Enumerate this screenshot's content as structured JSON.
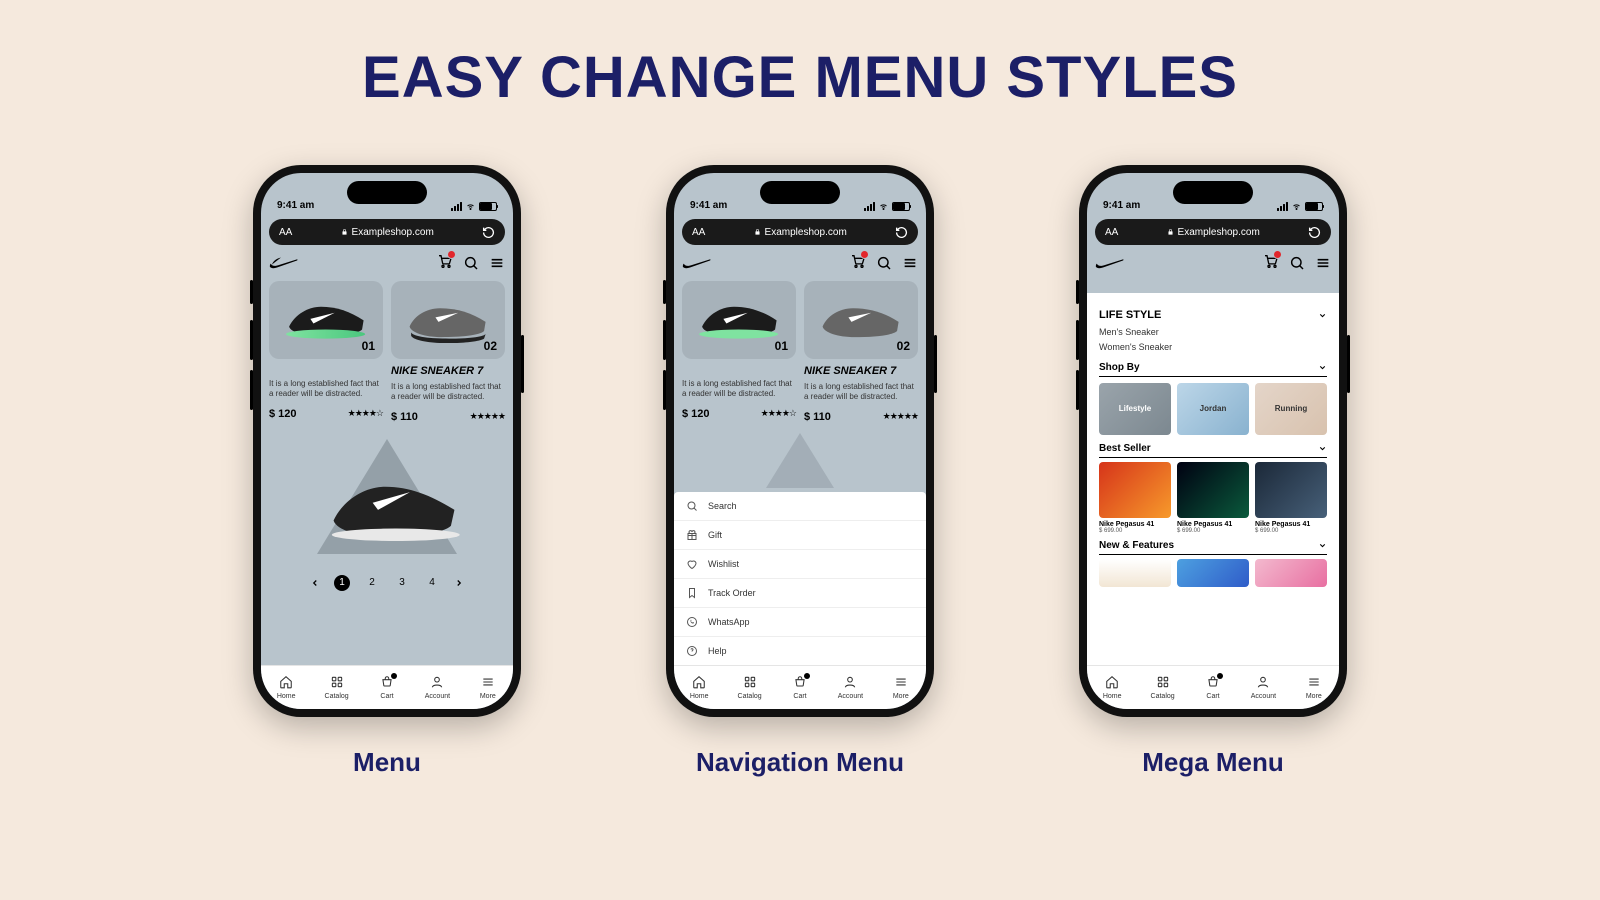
{
  "headline": "EASY CHANGE MENU STYLES",
  "captions": {
    "menu": "Menu",
    "nav": "Navigation Menu",
    "mega": "Mega Menu"
  },
  "status": {
    "time": "9:41 am"
  },
  "address": {
    "aa": "AA",
    "url": "Exampleshop.com"
  },
  "products": {
    "card1_num": "01",
    "card2_num": "02",
    "p2_name": "NIKE SNEAKER 7",
    "desc": "It is a long established fact that a reader will be distracted.",
    "p1_price": "$ 120",
    "p1_stars": "★★★★☆",
    "p2_price": "$ 110",
    "p2_stars": "★★★★★"
  },
  "pagination": {
    "p1": "1",
    "p2": "2",
    "p3": "3",
    "p4": "4"
  },
  "tabs": {
    "home": "Home",
    "catalog": "Catalog",
    "cart": "Cart",
    "account": "Account",
    "more": "More"
  },
  "nav": {
    "search": "Search",
    "gift": "Gift",
    "wishlist": "Wishlist",
    "track": "Track Order",
    "whatsapp": "WhatsApp",
    "help": "Help"
  },
  "mega": {
    "lifestyle": "LIFE STYLE",
    "mens": "Men's Sneaker",
    "womens": "Women's Sneaker",
    "shopby": "Shop By",
    "tiles": {
      "lifestyle": "Lifestyle",
      "jordan": "Jordan",
      "running": "Running"
    },
    "bestseller": "Best Seller",
    "bs_name": "Nike Pegasus 41",
    "bs_price": "$ 699.00",
    "newfeat": "New & Features"
  }
}
